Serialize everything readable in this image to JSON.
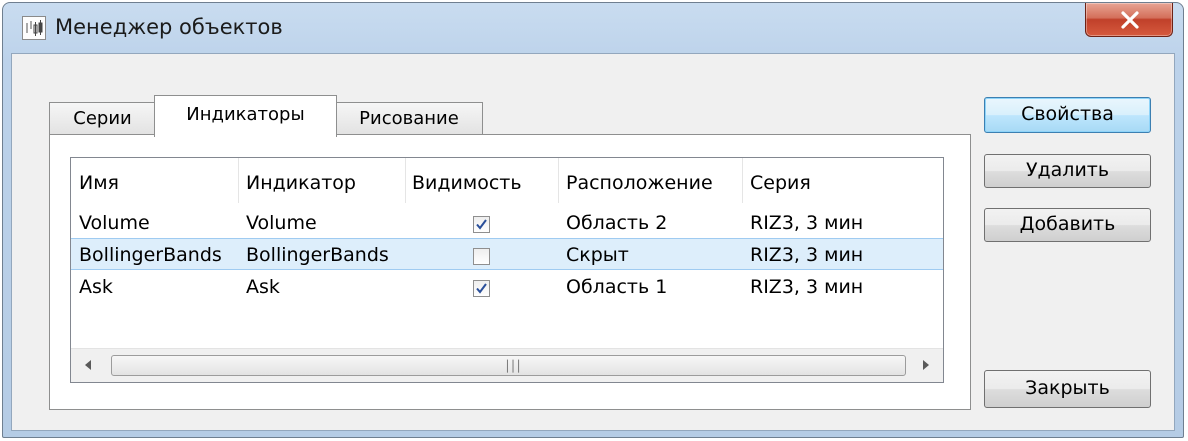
{
  "window": {
    "title": "Менеджер объектов"
  },
  "tabs": [
    {
      "label": "Серии",
      "active": false
    },
    {
      "label": "Индикаторы",
      "active": true
    },
    {
      "label": "Рисование",
      "active": false
    }
  ],
  "table": {
    "columns": [
      "Имя",
      "Индикатор",
      "Видимость",
      "Расположение",
      "Серия"
    ],
    "rows": [
      {
        "name": "Volume",
        "indicator": "Volume",
        "visible": true,
        "location": "Область 2",
        "series": "RIZ3, 3 мин",
        "selected": false
      },
      {
        "name": "BollingerBands",
        "indicator": "BollingerBands",
        "visible": false,
        "location": "Скрыт",
        "series": "RIZ3, 3 мин",
        "selected": true
      },
      {
        "name": "Ask",
        "indicator": "Ask",
        "visible": true,
        "location": "Область 1",
        "series": "RIZ3, 3 мин",
        "selected": false
      }
    ]
  },
  "buttons": {
    "properties": "Свойства",
    "delete": "Удалить",
    "add": "Добавить",
    "close": "Закрыть"
  },
  "colors": {
    "selection": "#ddeefb",
    "close_button": "#c7432c",
    "default_button_border": "#3c7fb1"
  }
}
